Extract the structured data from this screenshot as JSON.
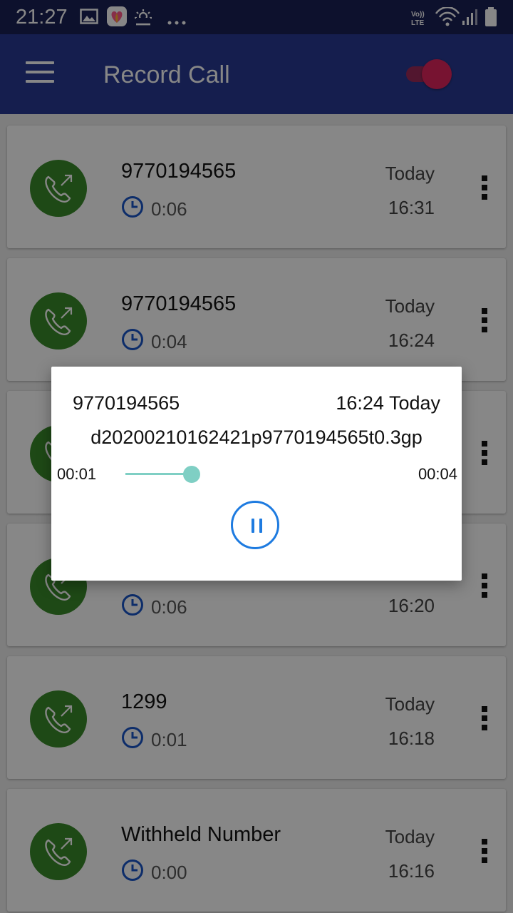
{
  "status_bar": {
    "time": "21:27",
    "icons": [
      "gallery-icon",
      "likee-app-icon",
      "weather-icon",
      "more-notifications-icon",
      "volte-icon",
      "wifi-icon",
      "signal-icon",
      "battery-icon"
    ],
    "volte_label": "Vo)) LTE"
  },
  "app_bar": {
    "title": "Record Call",
    "toggle_on": true,
    "colors": {
      "background": "#283a93",
      "toggle_thumb": "#e0245e",
      "toggle_track": "#9c2a5a"
    }
  },
  "recordings": [
    {
      "number": "9770194565",
      "duration": "0:06",
      "day": "Today",
      "time": "16:31"
    },
    {
      "number": "9770194565",
      "duration": "0:04",
      "day": "Today",
      "time": "16:24"
    },
    {
      "number": "",
      "duration": "",
      "day": "",
      "time": ""
    },
    {
      "number": "",
      "duration": "0:06",
      "day": "",
      "time": "16:20"
    },
    {
      "number": "1299",
      "duration": "0:01",
      "day": "Today",
      "time": "16:18"
    },
    {
      "number": "Withheld Number",
      "duration": "0:00",
      "day": "Today",
      "time": "16:16"
    }
  ],
  "list_colors": {
    "avatar": "#3a8a2a",
    "clock": "#1a55c8"
  },
  "player": {
    "number": "9770194565",
    "time": "16:24 Today",
    "filename": "d20200210162421p9770194565t0.3gp",
    "position": "00:01",
    "duration": "00:04",
    "progress": 0.31,
    "colors": {
      "seek": "#7fcfc4",
      "button": "#1e7be0"
    }
  }
}
